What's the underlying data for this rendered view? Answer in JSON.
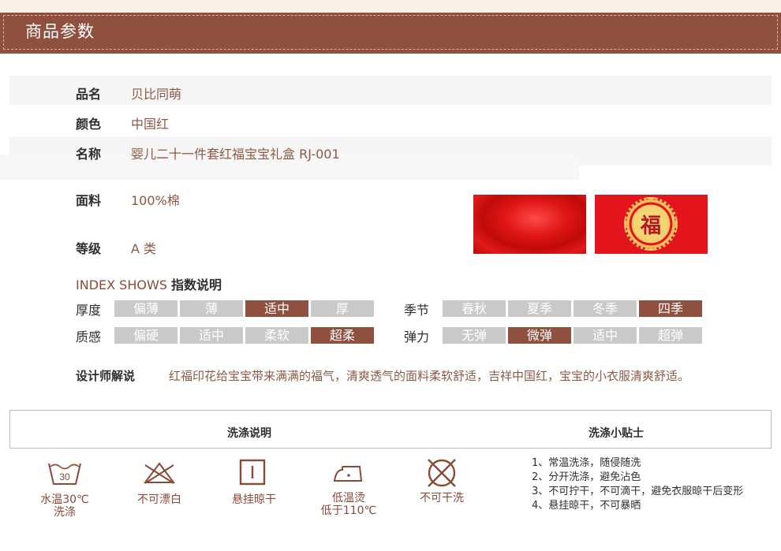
{
  "header": {
    "title": "商品参数"
  },
  "params": [
    {
      "label": "品名",
      "value": "贝比同萌"
    },
    {
      "label": "颜色",
      "value": "中国红"
    },
    {
      "label": "名称",
      "value": "婴儿二十一件套红福宝宝礼盒 RJ-001"
    },
    {
      "label": "面料",
      "value": "100%棉"
    },
    {
      "label": "等级",
      "value": "A 类"
    }
  ],
  "swatches": {
    "fu_char": "福"
  },
  "index": {
    "title_en": "INDEX SHOWS",
    "title_cn": "指数说明"
  },
  "scales": [
    {
      "label": "厚度",
      "options": [
        "偏薄",
        "薄",
        "适中",
        "厚"
      ],
      "selected_index": 2
    },
    {
      "label": "季节",
      "options": [
        "春秋",
        "夏季",
        "冬季",
        "四季"
      ],
      "selected_index": 3
    },
    {
      "label": "质感",
      "options": [
        "偏硬",
        "适中",
        "柔软",
        "超柔"
      ],
      "selected_index": 3
    },
    {
      "label": "弹力",
      "options": [
        "无弹",
        "微弹",
        "适中",
        "超弹"
      ],
      "selected_index": 1
    }
  ],
  "designer": {
    "label": "设计师解说",
    "text": "红福印花给宝宝带来满满的福气，清爽透气的面料柔软舒适，吉祥中国红，宝宝的小衣服清爽舒适。"
  },
  "wash": {
    "instructions_title": "洗涤说明",
    "tips_title": "洗涤小贴士",
    "temp_value": "30",
    "icons": [
      {
        "name": "wash-30-icon",
        "label_line1": "水温30℃",
        "label_line2": "洗涤"
      },
      {
        "name": "no-bleach-icon",
        "label_line1": "不可漂白",
        "label_line2": ""
      },
      {
        "name": "hang-dry-icon",
        "label_line1": "悬挂晾干",
        "label_line2": ""
      },
      {
        "name": "low-iron-icon",
        "label_line1": "低温烫",
        "label_line2": "低于110℃"
      },
      {
        "name": "no-dry-clean-icon",
        "label_line1": "不可干洗",
        "label_line2": ""
      }
    ],
    "tips": [
      "1、常温洗涤，随侵随洗",
      "2、分开洗涤，避免沾色",
      "3、不可拧干，不可滴干，避免衣服晾干后变形",
      "4、悬挂晾干，不可暴晒"
    ]
  },
  "colors": {
    "brand": "#8f5040",
    "inactive": "#c9c9c9",
    "value_text": "#8a5a45"
  }
}
